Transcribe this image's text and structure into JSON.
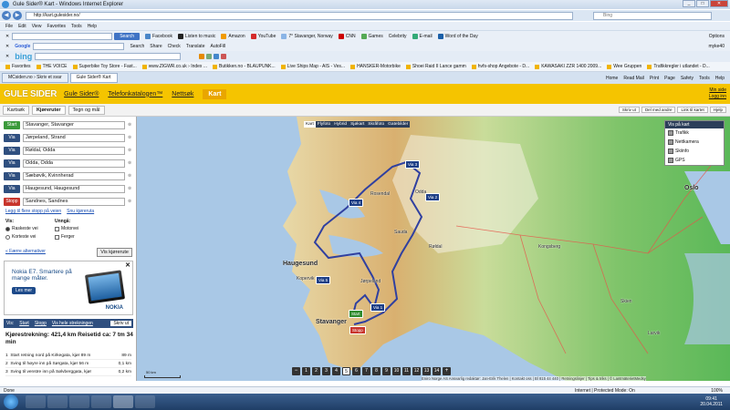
{
  "window": {
    "title": "Gule Sider® Kart - Windows Internet Explorer"
  },
  "address": {
    "url": "http://kart.gulesider.no/",
    "search_engine": "Bing"
  },
  "menu": [
    "File",
    "Edit",
    "View",
    "Favorites",
    "Tools",
    "Help"
  ],
  "toolbar1": {
    "search_button": "Search",
    "items": [
      "Facebook",
      "Listen to music",
      "Amazon",
      "YouTube",
      "7° Stavanger, Norway",
      "CNN",
      "Games",
      "Celebrity",
      "E-mail",
      "Word of the Day"
    ],
    "options": "Options"
  },
  "toolbar2": {
    "google_label": "Google",
    "items": [
      "Search",
      "Share",
      "Check",
      "Translate",
      "AutoFill"
    ],
    "bing_label": "bing",
    "user": "myke40"
  },
  "favorites": {
    "label": "Favorites",
    "items": [
      "THE VOICE",
      "Superbike Toy Store - Fast...",
      "www.ZIGWR.co.uk › Index ...",
      "Butikken.no - BLAUPUNK...",
      "Live Ships Map - AIS - Ves...",
      "HANSKER-Motorbike",
      "Shoei Raid II Lance gamm",
      "hvfs-shop Angebote - D...",
      "KAWASAKI ZZR 1400 2009...",
      "Wee Gruppen",
      "Trafikkregler i utlandet - D..."
    ]
  },
  "tabs": [
    {
      "label": "MCsiden.no › Skriv et svar"
    },
    {
      "label": "Gule Sider® Kart"
    }
  ],
  "browser_cmds": [
    "Home",
    "Read Mail",
    "Print",
    "Page",
    "Safety",
    "Tools",
    "Help"
  ],
  "site": {
    "logo": "GULE SIDER",
    "nav": [
      "Gule Sider®",
      "Telefonkatalogen™",
      "Nettsøk",
      "Kart"
    ],
    "login": [
      "Min side",
      "Logg inn"
    ]
  },
  "panel_tabs": [
    "Kartsøk",
    "Kjøreruter",
    "Tegn og mål"
  ],
  "map_tools": [
    "Skriv ut",
    "Del med andre",
    "Link til kartet",
    "Hjelp"
  ],
  "waypoints": [
    {
      "tag": "Start",
      "type": "start",
      "value": "Stavanger, Stavanger"
    },
    {
      "tag": "Via",
      "type": "via",
      "value": "Jørpeland, Strand"
    },
    {
      "tag": "Via",
      "type": "via",
      "value": "Røldal, Odda"
    },
    {
      "tag": "Via",
      "type": "via",
      "value": "Odda, Odda"
    },
    {
      "tag": "Via",
      "type": "via",
      "value": "Sæbøvik, Kvinnherad"
    },
    {
      "tag": "Via",
      "type": "via",
      "value": "Haugesund, Haugesund"
    },
    {
      "tag": "Stopp",
      "type": "stop",
      "value": "Sandnes, Sandnes"
    }
  ],
  "waypoint_links": {
    "add": "Legg til flere stopp på veien",
    "reverse": "Snu kjøreruta"
  },
  "options": {
    "vis_label": "Vis:",
    "unnga_label": "Unngå:",
    "route_options": [
      "Raskeste vei",
      "Korteste vei"
    ],
    "avoid_options": [
      "Motorvei",
      "Ferger"
    ],
    "fewer": "« Færre alternativer",
    "show_route": "Vis kjørerute"
  },
  "ad": {
    "headline": "Nokia E7. Smartere på mange måter.",
    "button": "Les mer",
    "brand": "NOKIA"
  },
  "directions": {
    "tabs": [
      "Vis:",
      "Start",
      "Stopp",
      "Vis hele strekningen"
    ],
    "print": "Skriv ut",
    "summary_distance": "Kjørestrekning: 421,4 km",
    "summary_time": "Reisetid ca: 7 tm 34 min",
    "steps": [
      {
        "n": "1",
        "text": "Start retning nord på Kirkegata, kjør 89 m",
        "dist": "89 m"
      },
      {
        "n": "2",
        "text": "Sving til høyre inn på Sørgata, kjør 56 m",
        "dist": "0,1 km"
      },
      {
        "n": "3",
        "text": "Sving til venstre inn på Sølvberggata, kjør",
        "dist": "0,2 km"
      }
    ]
  },
  "map": {
    "layers": [
      "Kart",
      "Flyfoto",
      "Hybrid",
      "Sjøkart",
      "Skråfoto",
      "Gatebilder"
    ],
    "overlay_title": "Vis på kart",
    "overlays": [
      "Trafikk",
      "Nettkamera",
      "Skiinfo",
      "GPS"
    ],
    "scale": "50 km",
    "zoom_levels": [
      "1",
      "2",
      "3",
      "4",
      "5",
      "6",
      "7",
      "8",
      "9",
      "10",
      "11",
      "12",
      "13",
      "14"
    ],
    "current_zoom": "5",
    "copyright": "Eniro Norge AS Ansvarlig redaktør: Jan-Erik Thelen | Kontakt oss | Bl 815 44 440 | Retningslinjer | Tips & triks | © LantmäterietMedsy"
  },
  "markers": [
    {
      "label": "Via 3",
      "type": "via"
    },
    {
      "label": "Via 4",
      "type": "via"
    },
    {
      "label": "Via 2",
      "type": "via"
    },
    {
      "label": "Via 5",
      "type": "via"
    },
    {
      "label": "Via 1",
      "type": "via"
    },
    {
      "label": "Start",
      "type": "start"
    },
    {
      "label": "Stopp",
      "type": "stop"
    }
  ],
  "places": [
    "Haugesund",
    "Stavanger",
    "Oslo",
    "Sauda",
    "Kongsberg",
    "Odda",
    "Kopervik",
    "Jørpeland",
    "Rosendal",
    "Røldal",
    "Skien",
    "Larvik"
  ],
  "status": {
    "left": "Done",
    "zone": "Internet | Protected Mode: On",
    "zoom": "100%"
  },
  "clock": {
    "time": "09:41",
    "date": "20.04.2011"
  },
  "colors": {
    "gule_yellow": "#f5c400",
    "route_blue": "#3040a0",
    "sea": "#a9c8e6"
  }
}
